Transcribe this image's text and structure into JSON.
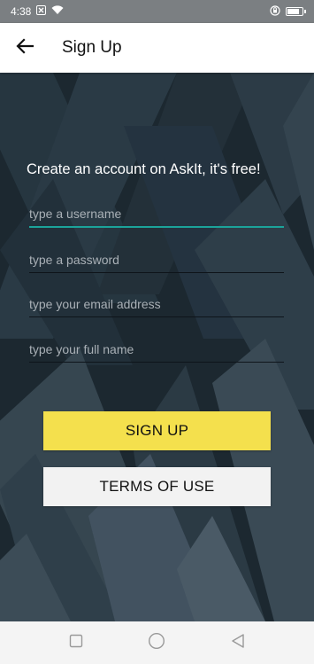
{
  "status_bar": {
    "time": "4:38",
    "icons": [
      "close-box-icon",
      "wifi-icon",
      "lock-rotation-icon",
      "battery-icon"
    ]
  },
  "app_bar": {
    "back_icon": "arrow-back-icon",
    "title": "Sign Up"
  },
  "form": {
    "headline": "Create an account on AskIt, it's free!",
    "username": {
      "value": "",
      "placeholder": "type a username"
    },
    "password": {
      "value": "",
      "placeholder": "type a password"
    },
    "email": {
      "value": "",
      "placeholder": "type your email address"
    },
    "full_name": {
      "value": "",
      "placeholder": "type your full name"
    }
  },
  "buttons": {
    "signup": "SIGN UP",
    "terms": "TERMS OF USE"
  },
  "nav_bar": {
    "icons": [
      "square-recents-icon",
      "circle-home-icon",
      "triangle-back-icon"
    ]
  },
  "colors": {
    "accent": "#1ba39a",
    "signup_button": "#f4e04d",
    "terms_button": "#f2f2f2",
    "background": "#1c2830"
  }
}
